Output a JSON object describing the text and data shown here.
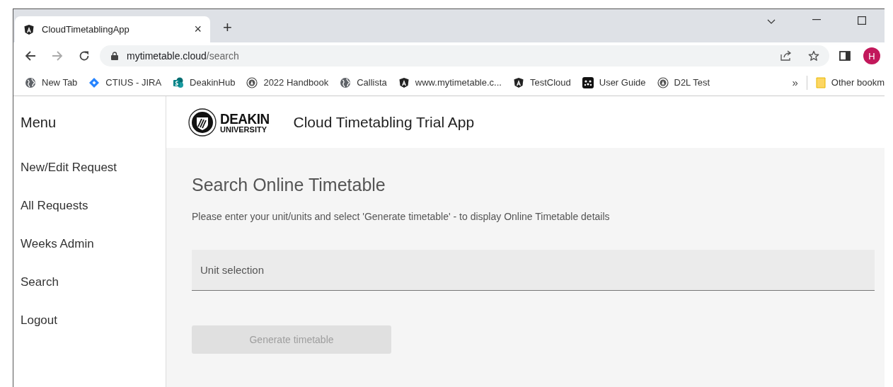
{
  "browser": {
    "tab": {
      "title": "CloudTimetablingApp",
      "close": "×",
      "selected": true
    },
    "new_tab": "+",
    "address": {
      "host": "mytimetable.cloud",
      "path": "/search"
    },
    "profile_initial": "H",
    "bookmarks": [
      {
        "label": "New Tab"
      },
      {
        "label": "CTIUS - JIRA"
      },
      {
        "label": "DeakinHub"
      },
      {
        "label": "2022 Handbook"
      },
      {
        "label": "Callista"
      },
      {
        "label": "www.mytimetable.c..."
      },
      {
        "label": "TestCloud"
      },
      {
        "label": "User Guide"
      },
      {
        "label": "D2L Test"
      }
    ],
    "more_bookmarks": "»",
    "other_bookmarks": "Other bookm"
  },
  "sidebar": {
    "title": "Menu",
    "items": [
      {
        "label": "New/Edit Request"
      },
      {
        "label": "All Requests"
      },
      {
        "label": "Weeks Admin"
      },
      {
        "label": "Search"
      },
      {
        "label": "Logout"
      }
    ]
  },
  "header": {
    "logo_top": "DEAKIN",
    "logo_bottom": "UNIVERSITY",
    "title": "Cloud Timetabling Trial App"
  },
  "main": {
    "heading": "Search Online Timetable",
    "instructions": "Please enter your unit/units and select 'Generate timetable' - to display Online Timetable details",
    "unit_field": {
      "placeholder": "Unit selection"
    },
    "generate_button": {
      "label": "Generate timetable",
      "disabled": true
    }
  }
}
